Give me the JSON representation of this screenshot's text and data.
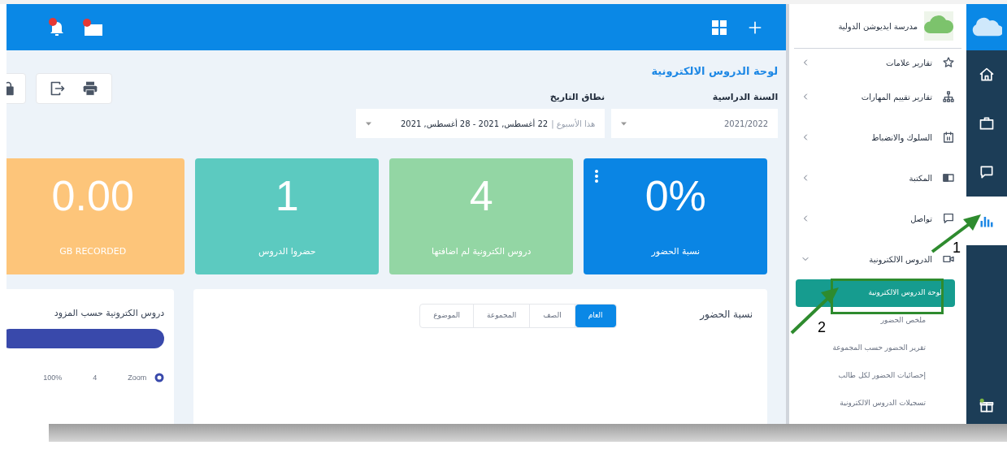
{
  "dashboard": {
    "title": "لوحة الدروس الالكترونية",
    "filters": [
      {
        "kind": "select",
        "label": "السنة الدراسية",
        "value": "2021/2022"
      },
      {
        "kind": "range",
        "label": "نطاق التاريخ",
        "prefix": "هذا الأسبوع |",
        "value": "22 أغسطس, 2021 - 28 أغسطس, 2021"
      }
    ],
    "stats": [
      {
        "value": "0%",
        "label": "نسبة الحضور",
        "color": "#0a85e4",
        "menu": true
      },
      {
        "value": "4",
        "label": "دروس الكترونية لم اضافتها",
        "color": "#93d6a4",
        "menu": false
      },
      {
        "value": "1",
        "label": "حضروا الدروس",
        "color": "#5ccac0",
        "menu": false
      },
      {
        "value": "0.00",
        "label": "GB RECORDED",
        "color": "#fdc57a",
        "menu": false
      }
    ],
    "attendance_panel": {
      "title": "نسبة الحضور",
      "tabs": [
        {
          "label": "العام",
          "selected": true
        },
        {
          "label": "الصف",
          "selected": false
        },
        {
          "label": "المجموعة",
          "selected": false
        },
        {
          "label": "الموضوع",
          "selected": false
        }
      ]
    },
    "provider_panel": {
      "title": "دروس الكترونية حسب المزود",
      "legend": [
        {
          "name": "Zoom",
          "count": "4",
          "share": "100%"
        }
      ]
    }
  },
  "sidebar": {
    "school_name": "مدرسة ايديوشن الدولية",
    "items": [
      {
        "label": "تقارير علامات",
        "expanded": false
      },
      {
        "label": "تقارير تقييم المهارات",
        "expanded": false
      },
      {
        "label": "السلوك والانضباط",
        "expanded": false
      },
      {
        "label": "المكتبة",
        "expanded": false
      },
      {
        "label": "تواصل",
        "expanded": false
      },
      {
        "label": "الدروس الالكترونية",
        "expanded": true,
        "children": [
          {
            "label": "لوحة الدروس الالكترونية",
            "selected": true
          },
          {
            "label": "ملخص الحضور",
            "selected": false
          },
          {
            "label": "تقرير الحضور حسب المجموعة",
            "selected": false
          },
          {
            "label": "إحصائيات الحضور لكل طالب",
            "selected": false
          },
          {
            "label": "تسجيلات الدروس الالكترونية",
            "selected": false
          }
        ]
      }
    ]
  },
  "rail": {
    "items": [
      {
        "selected": false
      },
      {
        "selected": false
      },
      {
        "selected": false
      },
      {
        "selected": true
      },
      {
        "selected": false
      }
    ]
  },
  "annotations": [
    {
      "label": "1"
    },
    {
      "label": "2"
    }
  ]
}
